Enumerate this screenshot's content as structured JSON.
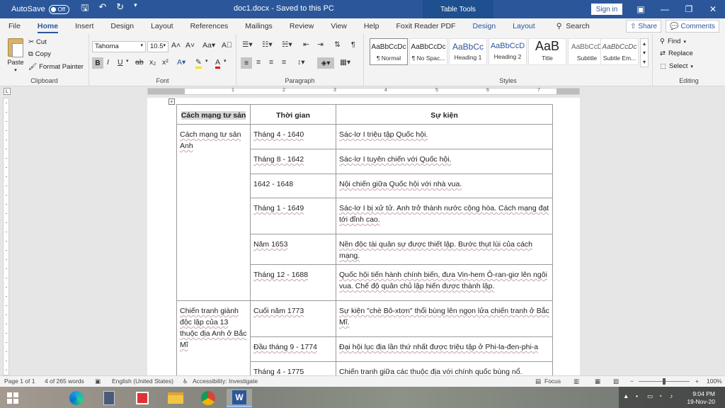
{
  "titlebar": {
    "autosave_label": "AutoSave",
    "autosave_state": "Off",
    "doc_title": "doc1.docx  -  Saved to this PC",
    "context_tab": "Table Tools",
    "signin": "Sign in"
  },
  "menu": {
    "tabs": [
      {
        "label": "File"
      },
      {
        "label": "Home"
      },
      {
        "label": "Insert"
      },
      {
        "label": "Design"
      },
      {
        "label": "Layout"
      },
      {
        "label": "References"
      },
      {
        "label": "Mailings"
      },
      {
        "label": "Review"
      },
      {
        "label": "View"
      },
      {
        "label": "Help"
      },
      {
        "label": "Foxit Reader PDF"
      },
      {
        "label": "Design"
      },
      {
        "label": "Layout"
      }
    ],
    "search": "Search",
    "share": "Share",
    "comments": "Comments"
  },
  "ribbon": {
    "clipboard": {
      "paste": "Paste",
      "cut": "Cut",
      "copy": "Copy",
      "painter": "Format Painter",
      "label": "Clipboard"
    },
    "font": {
      "family": "Tahoma",
      "size": "10.5",
      "label": "Font"
    },
    "paragraph": {
      "label": "Paragraph"
    },
    "styles": {
      "label": "Styles",
      "items": [
        {
          "preview": "AaBbCcDc",
          "name": "¶ Normal"
        },
        {
          "preview": "AaBbCcDc",
          "name": "¶ No Spac..."
        },
        {
          "preview": "AaBbCc",
          "name": "Heading 1"
        },
        {
          "preview": "AaBbCcD",
          "name": "Heading 2"
        },
        {
          "preview": "AaB",
          "name": "Title"
        },
        {
          "preview": "AaBbCcD",
          "name": "Subtitle"
        },
        {
          "preview": "AaBbCcDc",
          "name": "Subtle Em..."
        }
      ]
    },
    "editing": {
      "find": "Find",
      "replace": "Replace",
      "select": "Select",
      "label": "Editing"
    }
  },
  "ruler": {
    "numbers": [
      "1",
      "2",
      "3",
      "4",
      "5",
      "6",
      "7"
    ]
  },
  "table": {
    "headers": [
      "Cách mạng tư sản",
      "Thời gian",
      "Sự kiện"
    ],
    "groups": [
      {
        "name": "Cách mạng tư sản Anh",
        "rows": [
          {
            "time": "Tháng 4 - 1640",
            "event": "Sác-lơ I triệu tập Quốc hội."
          },
          {
            "time": "Tháng 8 - 1642",
            "event": "Sác-lơ I tuyên chiến với Quốc hội."
          },
          {
            "time": "1642 - 1648",
            "event": "Nội chiến giữa Quốc hội với nhà vua."
          },
          {
            "time": "Tháng 1 - 1649",
            "event": "Sác-lơ I bị xử tử. Anh trở thành nước cộng hòa. Cách mạng đạt tới đỉnh cao."
          },
          {
            "time": "Năm 1653",
            "event": "Nền độc tài quân sự được thiết lập. Bước thụt lùi của cách mạng."
          },
          {
            "time": "Tháng 12 - 1688",
            "event": "Quốc hội tiến hành chính biến, đưa Vin-hem Ô-ran-giơ lên ngôi vua. Chế độ quân chủ lập hiến được thành lập."
          }
        ]
      },
      {
        "name": "Chiến tranh giành độc lập của 13 thuộc địa Anh ở Bắc Mĩ",
        "rows": [
          {
            "time": "Cuối năm 1773",
            "event": "Sự kiện \"chè Bô-xtơn\" thổi bùng lên ngọn lửa chiến tranh ở Bắc Mĩ."
          },
          {
            "time": "Đầu tháng 9 - 1774",
            "event": "Đại hội lục địa lần thứ nhất được triệu tập ở Phi-la-đen-phi-a"
          },
          {
            "time": "Tháng 4 - 1775",
            "event": "Chiến tranh giữa các thuộc địa với chính quốc bùng nổ."
          }
        ]
      }
    ]
  },
  "status": {
    "page": "Page 1 of 1",
    "words": "4 of 265 words",
    "language": "English (United States)",
    "accessibility": "Accessibility: Investigate",
    "focus": "Focus",
    "zoom": "100%"
  },
  "taskbar": {
    "time": "9:04 PM",
    "date": "19-Nov-20"
  }
}
